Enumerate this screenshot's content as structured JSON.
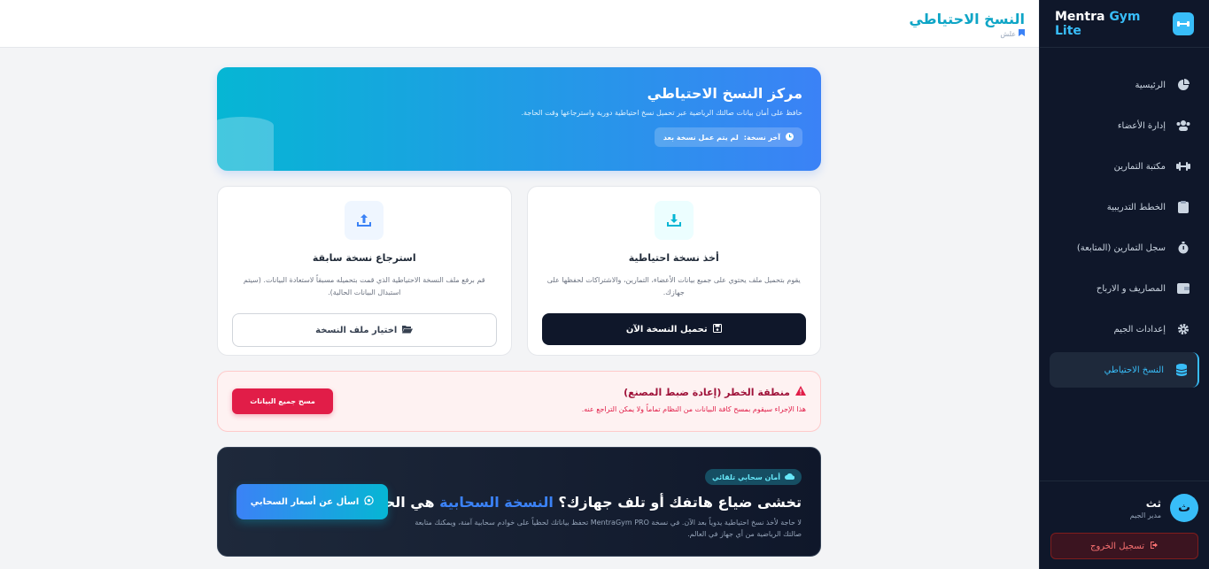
{
  "sidebar": {
    "brand": {
      "name_part1": "Mentra",
      "name_part2": "Gym Lite"
    },
    "items": [
      {
        "label": "الرئيسية",
        "icon": "pie-chart-icon"
      },
      {
        "label": "إدارة الأعضاء",
        "icon": "users-icon"
      },
      {
        "label": "مكتبة التمارين",
        "icon": "dumbbell-icon"
      },
      {
        "label": "الخطط التدريبية",
        "icon": "clipboard-icon"
      },
      {
        "label": "سجل التمارين (المتابعة)",
        "icon": "stopwatch-icon"
      },
      {
        "label": "المصاريف و الارباح",
        "icon": "wallet-icon"
      },
      {
        "label": "إعدادات الجيم",
        "icon": "gear-icon"
      },
      {
        "label": "النسخ الاحتياطي",
        "icon": "database-icon",
        "active": true
      }
    ],
    "user": {
      "initial": "ث",
      "name": "ثث",
      "role": "مدير الجيم"
    },
    "logout_label": "تسجيل الخروج"
  },
  "header": {
    "title": "النسخ الاحتياطي",
    "breadcrumb": "علش"
  },
  "hero": {
    "title": "مركز النسخ الاحتياطي",
    "description": "حافظ على أمان بيانات صالتك الرياضية عبر تحميل نسخ احتياطية دورية واسترجاعها وقت الحاجة.",
    "last_backup_label": "آخر نسخة:",
    "last_backup_value": "لم يتم عمل نسخة بعد"
  },
  "backup_card": {
    "title": "أخذ نسخة احتياطية",
    "description": "يقوم بتحميل ملف يحتوي على جميع بيانات الأعضاء، التمارين، والاشتراكات لحفظها على جهازك.",
    "button": "تحميل النسخة الآن"
  },
  "restore_card": {
    "title": "استرجاع نسخة سابقة",
    "description": "قم برفع ملف النسخة الاحتياطية الذي قمت بتحميله مسبقاً لاستعادة البيانات. (سيتم استبدال البيانات الحالية).",
    "button": "اختيار ملف النسخة"
  },
  "danger_zone": {
    "title": "منطقة الخطر (إعادة ضبط المصنع)",
    "description": "هذا الإجراء سيقوم بمسح كافة البيانات من النظام تماماً ولا يمكن التراجع عنه.",
    "button": "مسح جميع البيانات"
  },
  "promo": {
    "badge": "أمان سحابي تلقائي",
    "title_prefix": "تخشى ضياع هاتفك أو تلف جهازك؟",
    "title_highlight": "النسخة السحابية",
    "title_suffix": "هي الحل!",
    "description": "لا حاجة لأخذ نسخ احتياطية يدوياً بعد الآن. في نسخة MentraGym PRO تحفظ بياناتك لحظياً على خوادم سحابية آمنة، ويمكنك متابعة صالتك الرياضية من أي جهاز في العالم.",
    "button": "اسأل عن أسعار السحابي"
  },
  "colors": {
    "accent": "#38bdf8",
    "sidebar_bg": "#0f172a",
    "danger": "#e11d48"
  }
}
